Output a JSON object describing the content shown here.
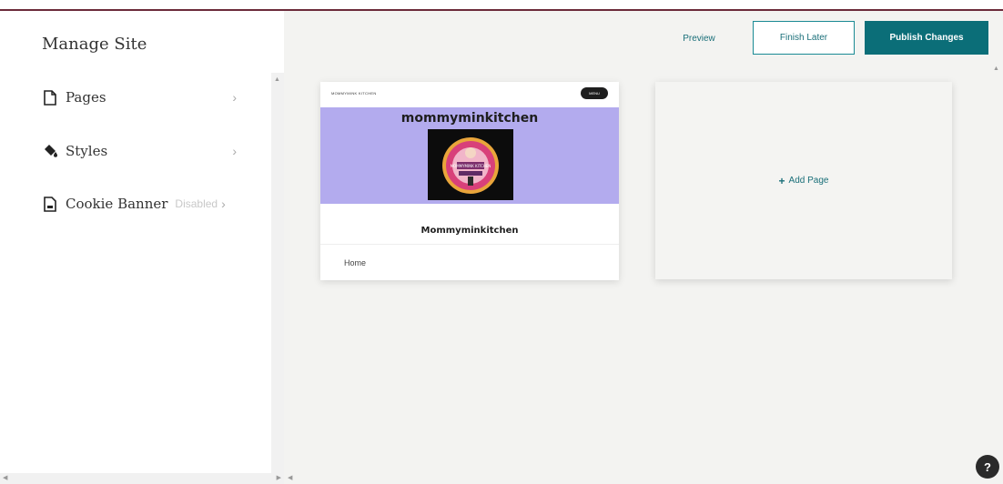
{
  "sidebar": {
    "title": "Manage Site",
    "items": [
      {
        "label": "Pages",
        "icon": "page-icon",
        "sub": ""
      },
      {
        "label": "Styles",
        "icon": "paint-bucket-icon",
        "sub": ""
      },
      {
        "label": "Cookie Banner",
        "icon": "document-icon",
        "sub": "Disabled"
      }
    ]
  },
  "header": {
    "preview_label": "Preview",
    "finish_later_label": "Finish Later",
    "publish_label": "Publish Changes"
  },
  "page_card": {
    "brand": "MOMMYMINK KITCHEN",
    "menu_label": "MENU",
    "hero_title": "mommyminkitchen",
    "logo_text": "MOMMYMINK KITCHEN",
    "site_name": "Mommyminkitchen",
    "page_name": "Home"
  },
  "add_page": {
    "label": "Add Page",
    "icon": "plus-icon"
  },
  "help": {
    "label": "?"
  },
  "colors": {
    "accent": "#0b6e78",
    "hero_bg": "#b3abee",
    "top_border": "#6b2a3a"
  }
}
